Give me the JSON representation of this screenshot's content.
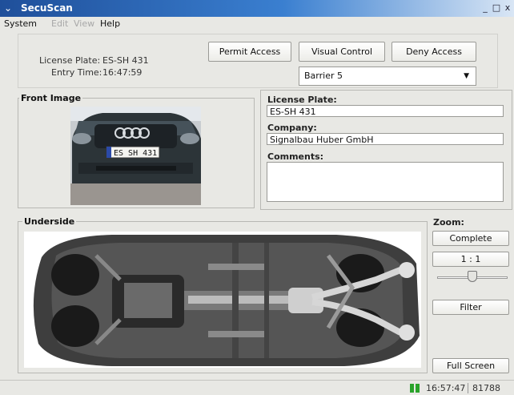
{
  "window": {
    "title": "SecuScan",
    "sys_icon": "chevron-down-icon",
    "minimize": "_",
    "maximize": "□",
    "close": "x"
  },
  "menu": {
    "items": [
      "System",
      "Edit",
      "View",
      "Help"
    ],
    "disabled": [
      "Edit",
      "View"
    ]
  },
  "info": {
    "plate_label": "License Plate:",
    "plate_value": "ES-SH 431",
    "entry_label": "Entry Time:",
    "entry_value": "16:47:59"
  },
  "actions": {
    "permit": "Permit Access",
    "visual": "Visual Control",
    "deny": "Deny Access"
  },
  "barrier": {
    "selected": "Barrier 5",
    "arrow": "▼"
  },
  "front_image": {
    "title": "Front Image",
    "plate_text": "ES SH 431"
  },
  "details": {
    "plate_label": "License Plate:",
    "plate_value": "ES-SH 431",
    "company_label": "Company:",
    "company_value": "Signalbau Huber GmbH",
    "comments_label": "Comments:",
    "comments_value": ""
  },
  "underside": {
    "title": "Underside"
  },
  "zoom": {
    "title": "Zoom:",
    "complete": "Complete",
    "ratio": "1 : 1",
    "level": 0.5,
    "filter": "Filter",
    "fullscreen": "Full Screen"
  },
  "status": {
    "time": "16:57:47",
    "memory": "81788 kB",
    "connection_color": "#2aa32a"
  }
}
